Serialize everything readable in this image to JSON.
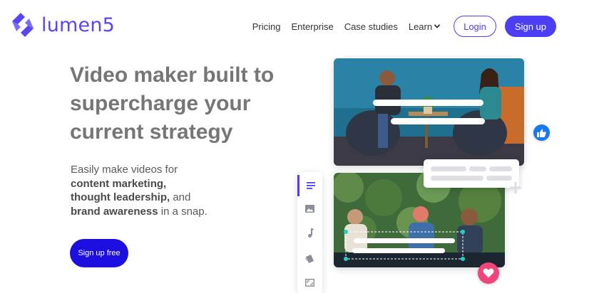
{
  "header": {
    "logo_text": "lumen5",
    "brand_color": "#5846f6",
    "nav": {
      "pricing": "Pricing",
      "enterprise": "Enterprise",
      "case_studies": "Case studies",
      "learn": "Learn"
    },
    "login_label": "Login",
    "signup_label": "Sign up"
  },
  "hero": {
    "title": "Video maker built to supercharge your current strategy",
    "subtitle": {
      "intro": "Easily make videos for",
      "item1": "content marketing,",
      "item2": "thought leadership,",
      "and_text": "and",
      "item3": "brand awareness",
      "outro": "in a snap."
    },
    "cta_label": "Sign up free",
    "cta_color": "#1c0fe0"
  },
  "editor_preview": {
    "toolbar_icons": [
      "text-icon",
      "image-icon",
      "music-icon",
      "style-icon",
      "format-icon"
    ],
    "badges": [
      "thumbs-up-icon",
      "heart-icon"
    ]
  }
}
